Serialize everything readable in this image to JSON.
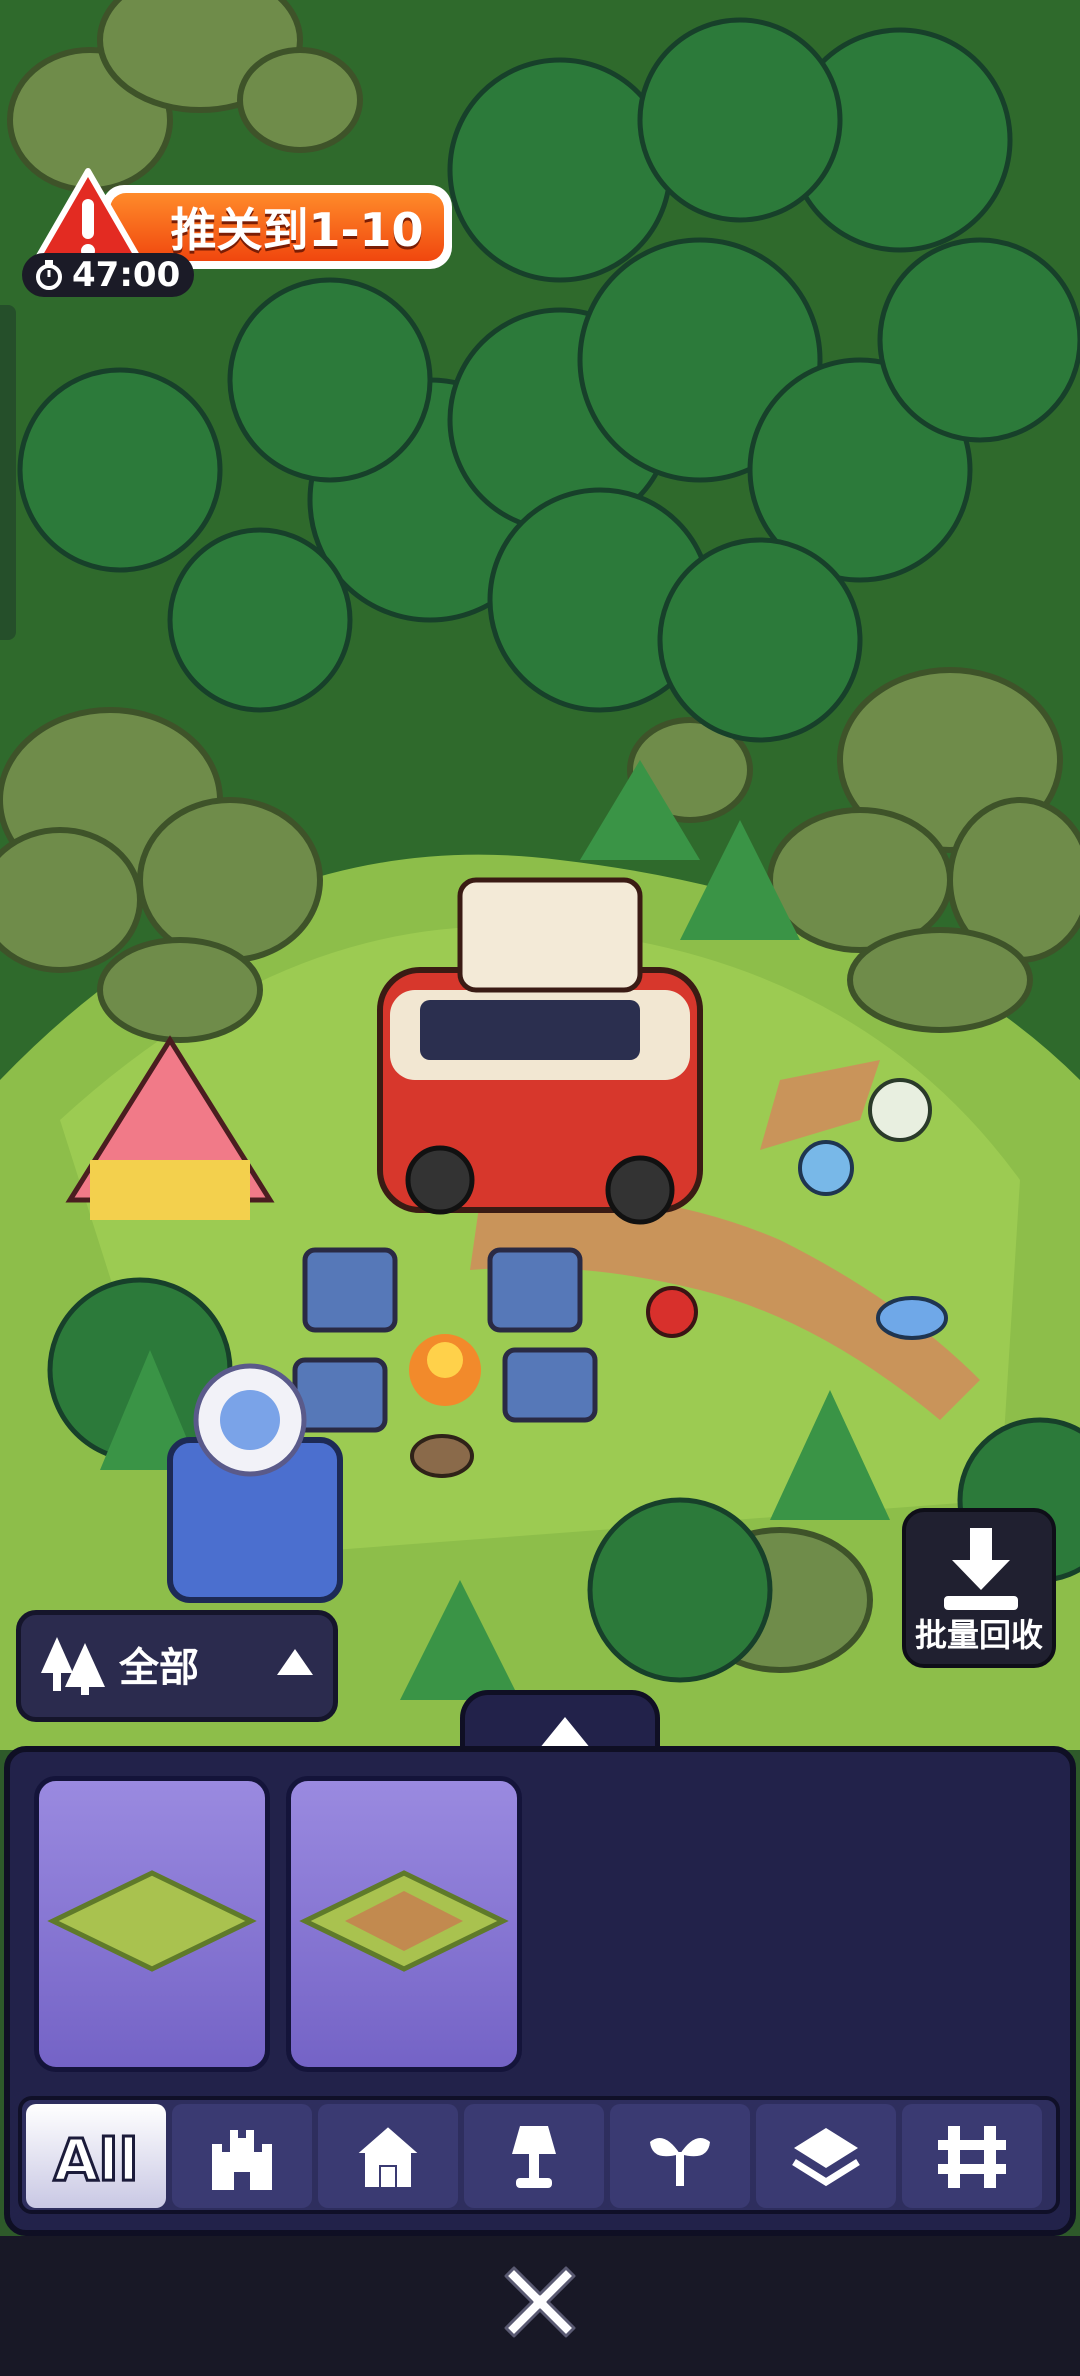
{
  "quest": {
    "title": "推关到1-10",
    "timer": "47:00",
    "icon": "warning-icon"
  },
  "batch_recycle": {
    "label": "批量回收",
    "icon": "download-icon"
  },
  "filter": {
    "label": "全部",
    "icon": "forest-icon"
  },
  "panel": {
    "expand_icon": "chevron-up-icon",
    "items": [
      {
        "name": "grass-tile",
        "color": "#a9c24f"
      },
      {
        "name": "dirt-path-tile",
        "color": "#c28a4f"
      }
    ],
    "tabs": [
      {
        "label": "All",
        "icon": "all-text",
        "active": true
      },
      {
        "label": "",
        "icon": "castle-icon",
        "active": false
      },
      {
        "label": "",
        "icon": "house-icon",
        "active": false
      },
      {
        "label": "",
        "icon": "lamp-icon",
        "active": false
      },
      {
        "label": "",
        "icon": "sprout-icon",
        "active": false
      },
      {
        "label": "",
        "icon": "layers-icon",
        "active": false
      },
      {
        "label": "",
        "icon": "fence-icon",
        "active": false
      }
    ]
  },
  "close_icon": "close-icon",
  "colors": {
    "panel_bg": "#22224a",
    "item_card": "#8a7ad8",
    "quest_orange": "#f26a1c",
    "forest_green": "#3f7a33"
  }
}
